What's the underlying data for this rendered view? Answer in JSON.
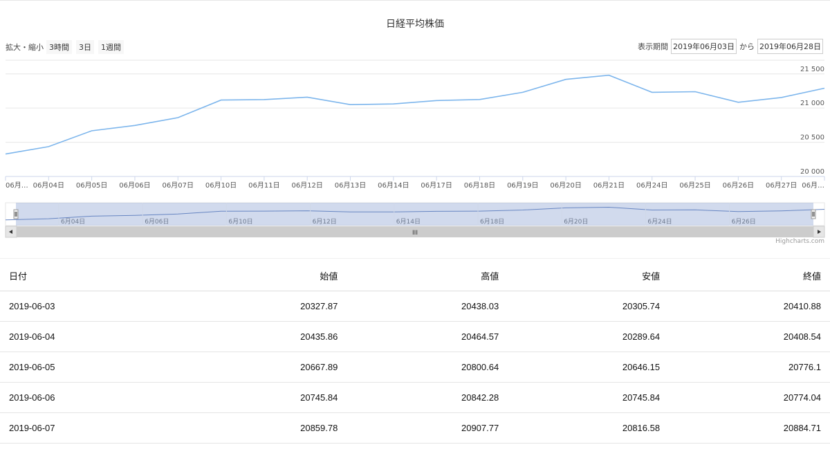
{
  "chart_data": {
    "type": "line",
    "title": "日経平均株価",
    "x": [
      "06月03日",
      "06月04日",
      "06月05日",
      "06月06日",
      "06月07日",
      "06月10日",
      "06月11日",
      "06月12日",
      "06月13日",
      "06月14日",
      "06月17日",
      "06月18日",
      "06月19日",
      "06月20日",
      "06月21日",
      "06月24日",
      "06月25日",
      "06月26日",
      "06月27日",
      "06月28日"
    ],
    "x_tick_labels": [
      "06月…",
      "06月04日",
      "06月05日",
      "06月06日",
      "06月07日",
      "06月10日",
      "06月11日",
      "06月12日",
      "06月13日",
      "06月14日",
      "06月17日",
      "06月18日",
      "06月19日",
      "06月20日",
      "06月21日",
      "06月24日",
      "06月25日",
      "06月26日",
      "06月27日",
      "06月…"
    ],
    "series": [
      {
        "values": [
          20410.88,
          20408.54,
          20776.1,
          20774.04,
          20884.71,
          21134.42,
          21204.28,
          21129.72,
          21032.0,
          21116.89,
          21124.0,
          20972.71,
          21333.87,
          21462.86,
          21258.64,
          21285.99,
          21193.81,
          21086.59,
          21338.17,
          21275.92
        ]
      }
    ],
    "series_plot": [
      20327.87,
      20435.86,
      20667.89,
      20745.84,
      20859.78,
      21116.89,
      21124.0,
      21160.0,
      21050.0,
      21060.0,
      21110.0,
      21125.0,
      21230.0,
      21420.0,
      21480.0,
      21230.0,
      21240.0,
      21085.0,
      21155.0,
      21290.0
    ],
    "y_ticks": [
      20000,
      20500,
      21000,
      21500
    ],
    "y_tick_labels": [
      "20 000",
      "20 500",
      "21 000",
      "21 500"
    ],
    "ylim": [
      20000,
      21700
    ],
    "navigator_labels": [
      "6月04日",
      "6月06日",
      "6月10日",
      "6月12日",
      "6月14日",
      "6月18日",
      "6月20日",
      "6月24日",
      "6月26日"
    ],
    "line_color": "#7cb5ec",
    "grid": true
  },
  "range_selector": {
    "zoom_label": "拡大・縮小",
    "buttons": [
      "3時間",
      "3日",
      "1週間"
    ],
    "period_label": "表示期間",
    "from_value": "2019年06月03日",
    "to_label": "から",
    "to_value": "2019年06月28日"
  },
  "credits": "Highcharts.com",
  "navigator": {
    "grip": "III"
  },
  "table": {
    "headers": [
      "日付",
      "始値",
      "高値",
      "安値",
      "終値"
    ],
    "rows": [
      [
        "2019-06-03",
        "20327.87",
        "20438.03",
        "20305.74",
        "20410.88"
      ],
      [
        "2019-06-04",
        "20435.86",
        "20464.57",
        "20289.64",
        "20408.54"
      ],
      [
        "2019-06-05",
        "20667.89",
        "20800.64",
        "20646.15",
        "20776.1"
      ],
      [
        "2019-06-06",
        "20745.84",
        "20842.28",
        "20745.84",
        "20774.04"
      ],
      [
        "2019-06-07",
        "20859.78",
        "20907.77",
        "20816.58",
        "20884.71"
      ]
    ]
  }
}
